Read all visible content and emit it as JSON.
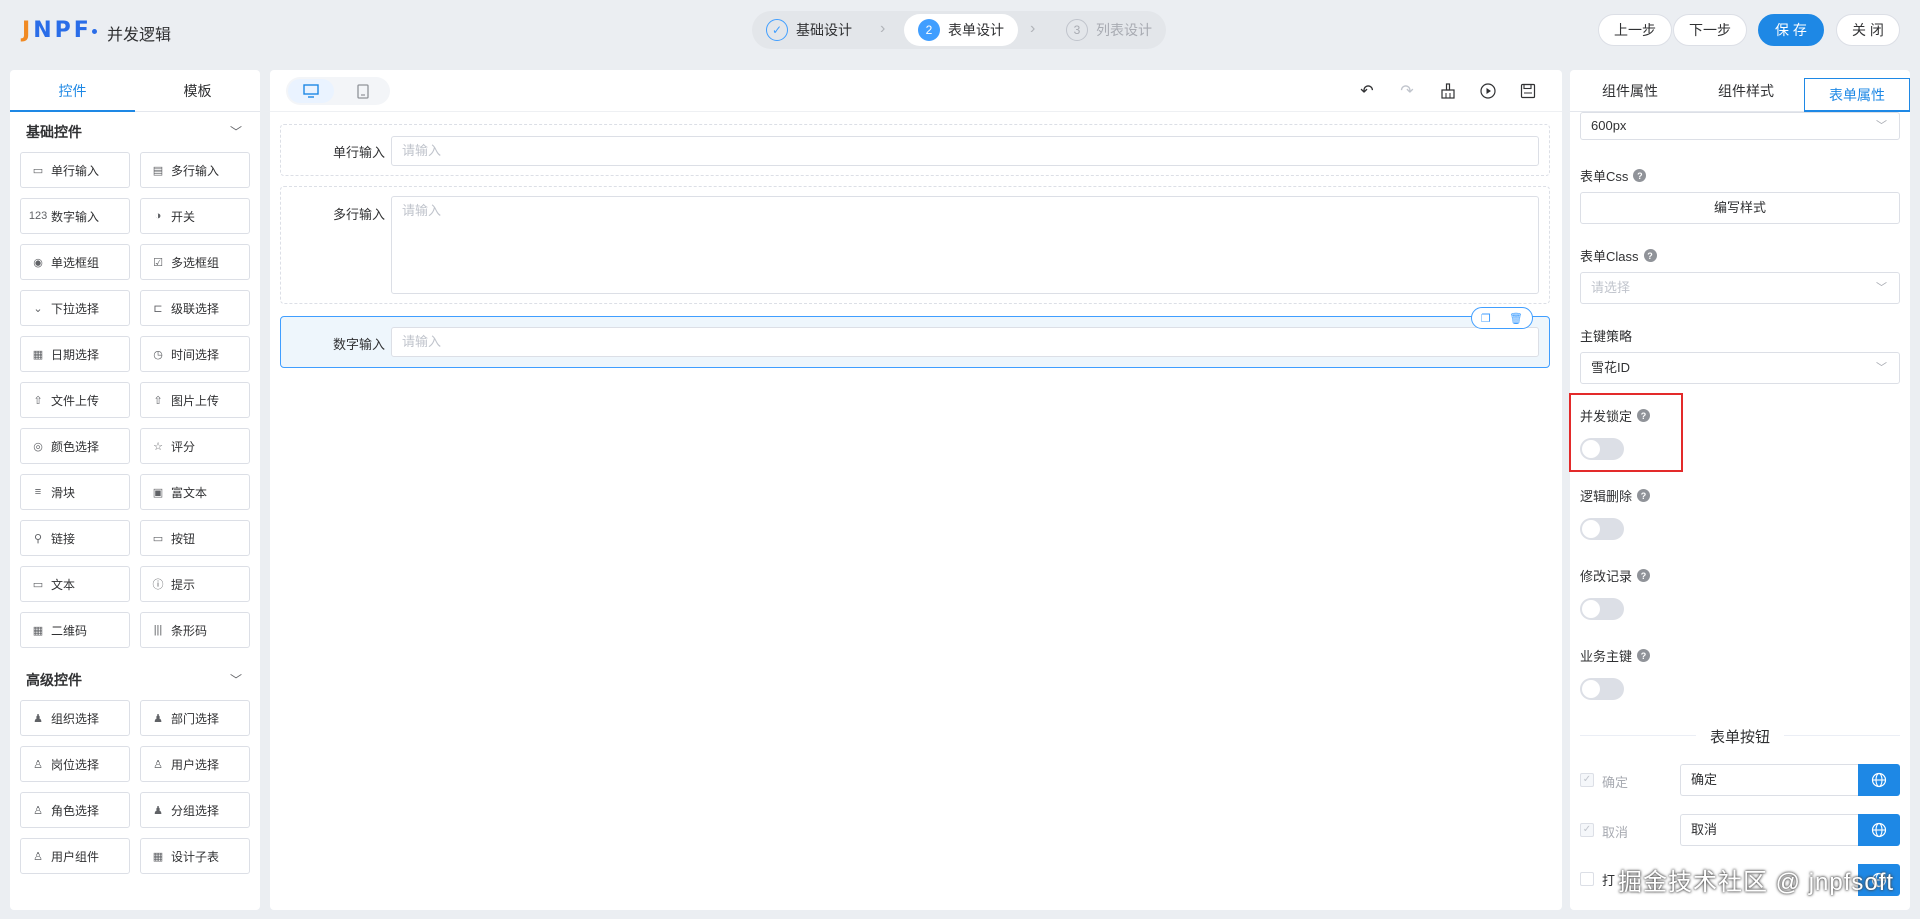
{
  "app": {
    "logo": "JNPF",
    "title": "并发逻辑"
  },
  "steps": [
    {
      "num": "✓",
      "label": "基础设计"
    },
    {
      "num": "2",
      "label": "表单设计"
    },
    {
      "num": "3",
      "label": "列表设计"
    }
  ],
  "top_buttons": {
    "prev": "上一步",
    "next": "下一步",
    "save": "保 存",
    "close": "关 闭"
  },
  "left_panel": {
    "tabs": [
      "控件",
      "模板"
    ],
    "basic_title": "基础控件",
    "basic_items": [
      {
        "label": "单行输入",
        "icon": "▭"
      },
      {
        "label": "多行输入",
        "icon": "▤"
      },
      {
        "label": "数字输入",
        "icon": "123"
      },
      {
        "label": "开关",
        "icon": "◑"
      },
      {
        "label": "单选框组",
        "icon": "◉"
      },
      {
        "label": "多选框组",
        "icon": "☑"
      },
      {
        "label": "下拉选择",
        "icon": "⌄"
      },
      {
        "label": "级联选择",
        "icon": "⊏"
      },
      {
        "label": "日期选择",
        "icon": "▦"
      },
      {
        "label": "时间选择",
        "icon": "◷"
      },
      {
        "label": "文件上传",
        "icon": "⇧"
      },
      {
        "label": "图片上传",
        "icon": "⇧"
      },
      {
        "label": "颜色选择",
        "icon": "◎"
      },
      {
        "label": "评分",
        "icon": "☆"
      },
      {
        "label": "滑块",
        "icon": "≡"
      },
      {
        "label": "富文本",
        "icon": "▣"
      },
      {
        "label": "链接",
        "icon": "⚲"
      },
      {
        "label": "按钮",
        "icon": "▭"
      },
      {
        "label": "文本",
        "icon": "▭"
      },
      {
        "label": "提示",
        "icon": "ⓘ"
      },
      {
        "label": "二维码",
        "icon": "▦"
      },
      {
        "label": "条形码",
        "icon": "|||"
      }
    ],
    "advanced_title": "高级控件",
    "advanced_items": [
      {
        "label": "组织选择",
        "icon": "♟"
      },
      {
        "label": "部门选择",
        "icon": "♟"
      },
      {
        "label": "岗位选择",
        "icon": "♙"
      },
      {
        "label": "用户选择",
        "icon": "♙"
      },
      {
        "label": "角色选择",
        "icon": "♙"
      },
      {
        "label": "分组选择",
        "icon": "♟"
      },
      {
        "label": "用户组件",
        "icon": "♙"
      },
      {
        "label": "设计子表",
        "icon": "▦"
      }
    ]
  },
  "canvas": {
    "fields": [
      {
        "label": "单行输入",
        "placeholder": "请输入"
      },
      {
        "label": "多行输入",
        "placeholder": "请输入"
      },
      {
        "label": "数字输入",
        "placeholder": "请输入"
      }
    ]
  },
  "right_panel": {
    "tabs": [
      "组件属性",
      "组件样式",
      "表单属性"
    ],
    "width_value": "600px",
    "form_css_label": "表单Css",
    "form_css_button": "编写样式",
    "form_class_label": "表单Class",
    "form_class_placeholder": "请选择",
    "pk_label": "主键策略",
    "pk_value": "雪花ID",
    "concurrency_lock": {
      "label": "并发锁定",
      "on": false
    },
    "logic_delete": {
      "label": "逻辑删除",
      "on": false
    },
    "modify_log": {
      "label": "修改记录",
      "on": false
    },
    "business_key": {
      "label": "业务主键",
      "on": false
    },
    "form_buttons_title": "表单按钮",
    "buttons": [
      {
        "check": "确定",
        "value": "确定"
      },
      {
        "check": "取消",
        "value": "取消"
      },
      {
        "check": "打"
      }
    ]
  },
  "watermark": "掘金技术社区 @ jnpfsoft",
  "colors": {
    "accent": "#1e88e5",
    "highlight_box": "#e32a2a"
  }
}
